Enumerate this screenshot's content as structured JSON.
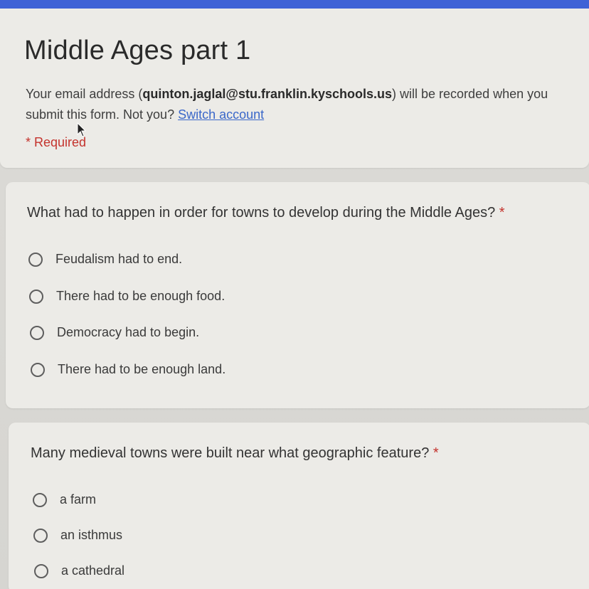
{
  "form": {
    "title": "Middle Ages part 1",
    "email_prefix": "Your email address (",
    "email": "quinton.jaglal@stu.franklin.kyschools.us",
    "email_suffix": ") will be recorded when you submit this form. Not you?",
    "switch_account": "Switch account",
    "required_note": "* Required",
    "accent_color": "#3f62d6"
  },
  "questions": [
    {
      "text": "What had to happen in order for towns to develop during the Middle Ages?",
      "required_mark": "*",
      "options": [
        "Feudalism had to end.",
        "There had to be enough food.",
        "Democracy had to begin.",
        "There had to be enough land."
      ]
    },
    {
      "text": "Many medieval towns were built near what geographic feature?",
      "required_mark": "*",
      "options": [
        "a farm",
        "an isthmus",
        "a cathedral"
      ]
    }
  ]
}
